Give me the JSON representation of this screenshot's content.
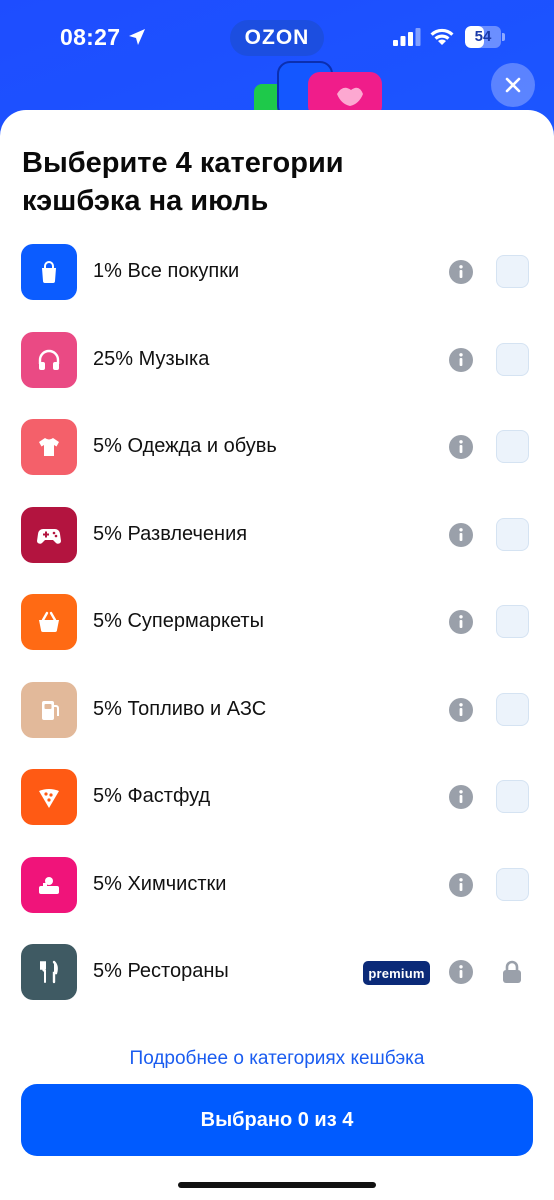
{
  "status_bar": {
    "time": "08:27",
    "brand": "OZON",
    "battery": "54",
    "battery_level": 0.54
  },
  "sheet": {
    "title": "Выберите 4 категории кэшбэка на июль"
  },
  "categories": [
    {
      "label": "1% Все покупки",
      "icon": "shopping-bag-icon",
      "color": "#0b5cff",
      "locked": false
    },
    {
      "label": "25% Музыка",
      "icon": "headphones-icon",
      "color": "#ea4a84",
      "locked": false
    },
    {
      "label": "5% Одежда и обувь",
      "icon": "tshirt-icon",
      "color": "#f4606a",
      "locked": false
    },
    {
      "label": "5% Развлечения",
      "icon": "gamepad-icon",
      "color": "#b3143f",
      "locked": false
    },
    {
      "label": "5% Супермаркеты",
      "icon": "basket-icon",
      "color": "#ff6a14",
      "locked": false
    },
    {
      "label": "5% Топливо и АЗС",
      "icon": "fuel-pump-icon",
      "color": "#e2b99a",
      "locked": false
    },
    {
      "label": "5% Фастфуд",
      "icon": "pizza-icon",
      "color": "#ff5a14",
      "locked": false
    },
    {
      "label": "5% Химчистки",
      "icon": "dry-cleaning-icon",
      "color": "#f0147a",
      "locked": false
    },
    {
      "label": "5% Рестораны",
      "icon": "fork-knife-icon",
      "color": "#3f5a63",
      "locked": true,
      "badge": "premium"
    }
  ],
  "more_link": "Подробнее о категориях кешбэка",
  "main_button": "Выбрано 0 из 4"
}
